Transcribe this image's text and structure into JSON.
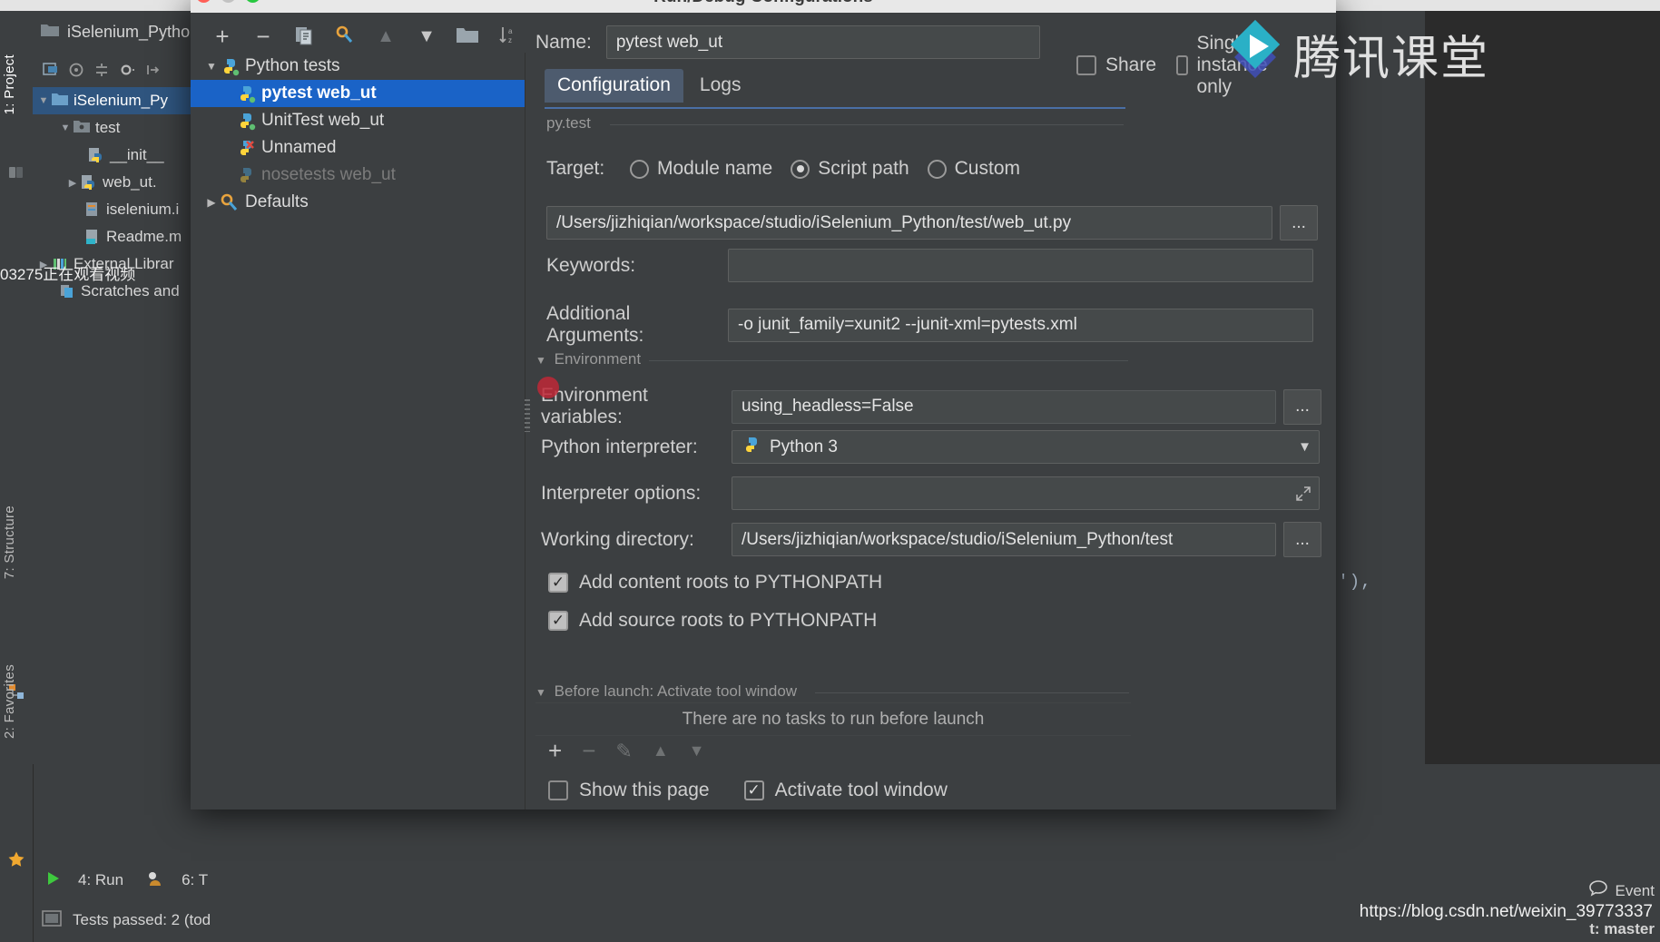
{
  "window": {
    "dialog_title": "Run/Debug Configurations",
    "traffic_lights": [
      "close-red",
      "minimize-yellow",
      "zoom-green"
    ]
  },
  "project_panel": {
    "header_title": "iSelenium_Python",
    "toolbar_icons": [
      "select-opened-file-icon",
      "target-icon",
      "collapse-all-icon",
      "settings-gear-icon",
      "hide-icon"
    ],
    "tree": [
      {
        "label": "iSelenium_Py",
        "indent": 0,
        "twisty": "▼",
        "icon": "folder-icon",
        "selected": true
      },
      {
        "label": "test",
        "indent": 1,
        "twisty": "▼",
        "icon": "folder-src-icon",
        "selected": false
      },
      {
        "label": "__init__",
        "indent": 2,
        "twisty": "",
        "icon": "python-file-icon",
        "selected": false
      },
      {
        "label": "web_ut.",
        "indent": 2,
        "twisty": "▶",
        "icon": "python-file-icon",
        "selected": false
      },
      {
        "label": "iselenium.i",
        "indent": 1,
        "twisty": "",
        "icon": "file-icon",
        "selected": false
      },
      {
        "label": "Readme.m",
        "indent": 1,
        "twisty": "",
        "icon": "markdown-file-icon",
        "selected": false
      },
      {
        "label": "External Librar",
        "indent": 0,
        "twisty": "▶",
        "icon": "library-icon",
        "selected": false
      },
      {
        "label": "Scratches and",
        "indent": 0,
        "twisty": "",
        "icon": "scratches-icon",
        "selected": false
      }
    ]
  },
  "tool_windows": {
    "left_tabs": [
      {
        "label": "1: Project",
        "active": true
      },
      {
        "label": "7: Structure",
        "active": false
      },
      {
        "label": "2: Favorites",
        "active": false
      }
    ]
  },
  "status_bar": {
    "run_label": "4: Run",
    "run_number": "4",
    "todo_label": "6: T",
    "todo_number": "6",
    "tests_status": "Tests passed: 2 (tod",
    "event_log": "Event",
    "branch": "t: master"
  },
  "editor": {
    "code_fragment": "r'),"
  },
  "config_list": {
    "toolbar": [
      "add-icon",
      "remove-icon",
      "copy-configuration-icon",
      "edit-templates-icon",
      "move-up-icon",
      "move-down-icon",
      "folder-icon",
      "sort-configurations-icon"
    ],
    "toolbar_glyphs": [
      "+",
      "−",
      "⎘",
      "⚙",
      "▲",
      "▼",
      "▰",
      "↓"
    ],
    "items": [
      {
        "label": "Python tests",
        "indent": 0,
        "twisty": "▼",
        "icon": "python-tests-icon",
        "selected": false,
        "dim": false
      },
      {
        "label": "pytest web_ut",
        "indent": 1,
        "twisty": "",
        "icon": "pytest-icon",
        "selected": true,
        "dim": false
      },
      {
        "label": "UnitTest web_ut",
        "indent": 1,
        "twisty": "",
        "icon": "python-test-icon",
        "selected": false,
        "dim": false
      },
      {
        "label": "Unnamed",
        "indent": 1,
        "twisty": "",
        "icon": "python-test-error-icon",
        "selected": false,
        "dim": false
      },
      {
        "label": "nosetests web_ut",
        "indent": 1,
        "twisty": "",
        "icon": "nosetests-icon",
        "selected": false,
        "dim": true
      },
      {
        "label": "Defaults",
        "indent": 0,
        "twisty": "▶",
        "icon": "defaults-icon",
        "selected": false,
        "dim": false
      }
    ]
  },
  "form": {
    "name_label": "Name:",
    "name_value": "pytest web_ut",
    "share_label": "Share",
    "share_checked": false,
    "single_instance_label": "Single instance only",
    "single_instance_checked": false,
    "tabs": [
      {
        "label": "Configuration",
        "active": true
      },
      {
        "label": "Logs",
        "active": false
      }
    ],
    "section_pytest": "py.test",
    "target_label": "Target:",
    "target_options": [
      {
        "label": "Module name",
        "selected": false
      },
      {
        "label": "Script path",
        "selected": true
      },
      {
        "label": "Custom",
        "selected": false
      }
    ],
    "script_path_value": "/Users/jizhiqian/workspace/studio/iSelenium_Python/test/web_ut.py",
    "keywords_label": "Keywords:",
    "keywords_value": "",
    "additional_arguments_label": "Additional Arguments:",
    "additional_arguments_value": "-o junit_family=xunit2 --junit-xml=pytests.xml",
    "section_environment": "Environment",
    "env_vars_label": "Environment variables:",
    "env_vars_value": "using_headless=False",
    "python_interpreter_label": "Python interpreter:",
    "python_interpreter_value": "Python 3",
    "interpreter_options_label": "Interpreter options:",
    "interpreter_options_value": "",
    "working_directory_label": "Working directory:",
    "working_directory_value": "/Users/jizhiqian/workspace/studio/iSelenium_Python/test",
    "add_content_roots_label": "Add content roots to PYTHONPATH",
    "add_content_roots_checked": true,
    "add_source_roots_label": "Add source roots to PYTHONPATH",
    "add_source_roots_checked": true,
    "before_launch_label": "Before launch: Activate tool window",
    "no_tasks_text": "There are no tasks to run before launch",
    "tasks_toolbar_glyphs": [
      "+",
      "−",
      "✎",
      "▲",
      "▼"
    ],
    "show_this_page_label": "Show this page",
    "show_this_page_checked": false,
    "activate_tool_window_label": "Activate tool window",
    "activate_tool_window_checked": true,
    "browse_button_label": "..."
  },
  "watermarks": {
    "brand_cn": "腾讯课堂",
    "left_overlay": "03275正在观看视频",
    "url": "https://blog.csdn.net/weixin_39773337"
  },
  "colors": {
    "accent_selected": "#1a63c7",
    "panel_bg": "#3c3f41",
    "field_bg": "#45494a",
    "text": "#bbbbbb",
    "tab_active_bg": "#4d5b6e"
  }
}
